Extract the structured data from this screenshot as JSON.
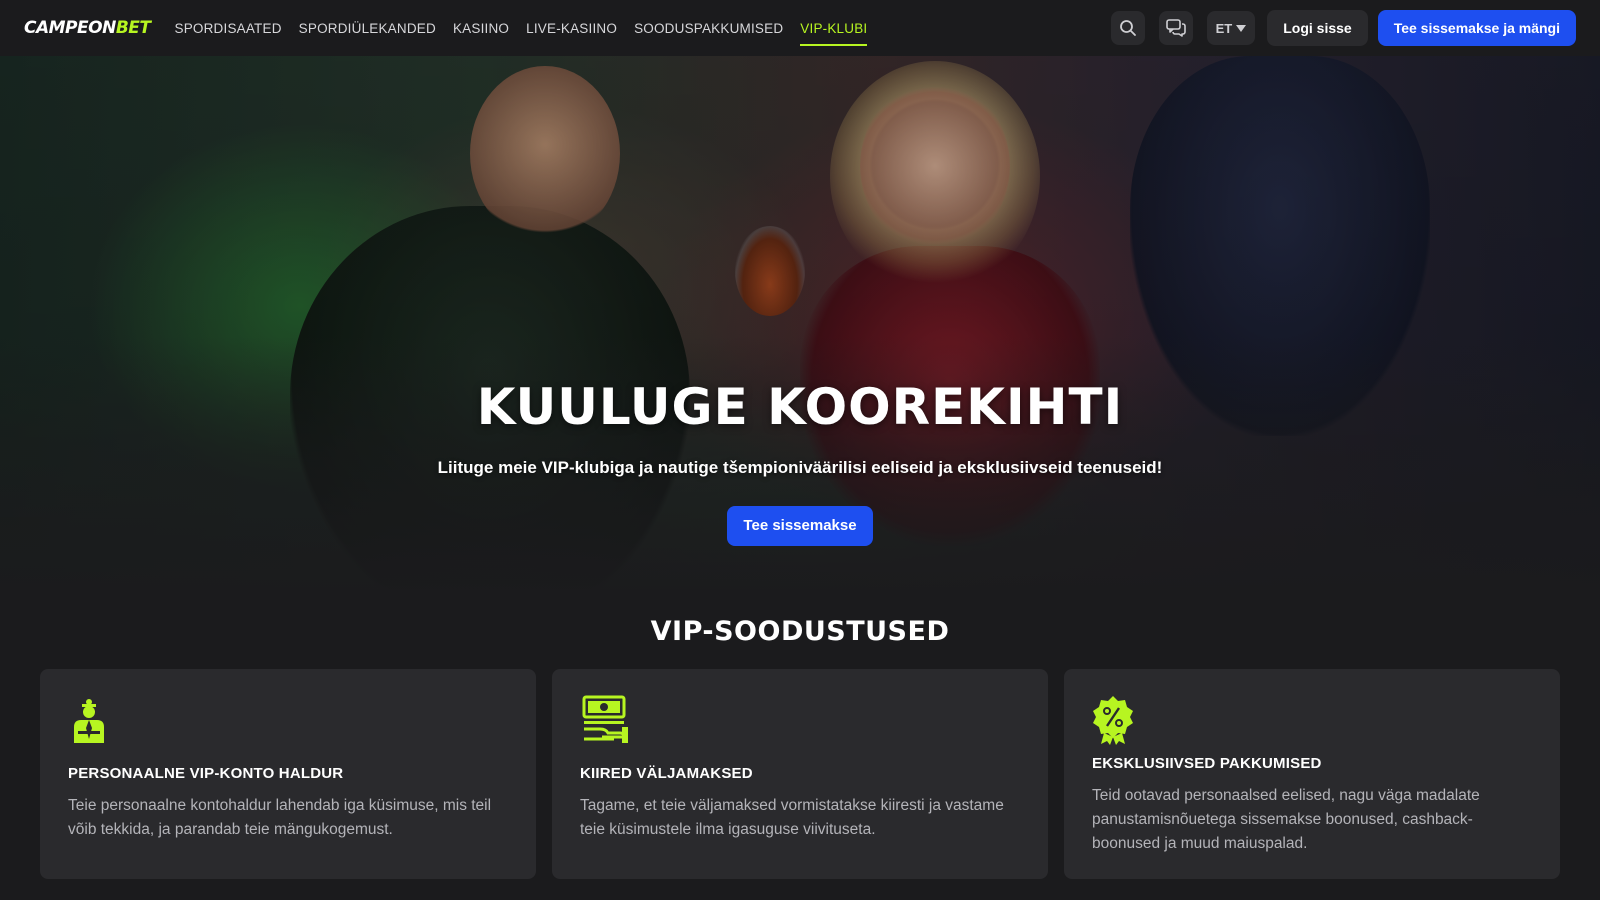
{
  "header": {
    "logo_part1": "CAMPEON",
    "logo_part2": "BET",
    "nav": [
      {
        "label": "SPORDISAATED",
        "active": false
      },
      {
        "label": "SPORDIÜLEKANDED",
        "active": false
      },
      {
        "label": "KASIINO",
        "active": false
      },
      {
        "label": "LIVE-KASIINO",
        "active": false
      },
      {
        "label": "SOODUSPAKKUMISED",
        "active": false
      },
      {
        "label": "VIP-KLUBI",
        "active": true
      }
    ],
    "search_icon": "search-icon",
    "chat_icon": "chat-bubbles-icon",
    "language": "ET",
    "login_label": "Logi sisse",
    "deposit_label": "Tee sissemakse ja mängi"
  },
  "hero": {
    "title": "KUULUGE KOOREKIHTI",
    "subtitle": "Liituge meie VIP-klubiga ja nautige tšempioniväärilisi eeliseid ja eksklusiivseid teenuseid!",
    "cta_label": "Tee sissemakse"
  },
  "benefits": {
    "title": "VIP-SOODUSTUSED",
    "cards": [
      {
        "icon": "personal-manager-icon",
        "title": "PERSONAALNE VIP-KONTO HALDUR",
        "text": "Teie personaalne kontohaldur lahendab iga küsimuse, mis teil võib tekkida, ja parandab teie mängukogemust."
      },
      {
        "icon": "fast-payout-icon",
        "title": "KIIRED VÄLJAMAKSED",
        "text": "Tagame, et teie väljamaksed vormistatakse kiiresti ja vastame teie küsimustele ilma igasuguse viivituseta."
      },
      {
        "icon": "exclusive-offer-badge-icon",
        "title": "EKSKLUSIIVSED PAKKUMISED",
        "text": "Teid ootavad personaalsed eelised, nagu väga madalate panustamisnõuetega sissemakse boonused, cashback-boonused ja muud maiuspalad."
      }
    ]
  },
  "colors": {
    "accent": "#b7f521",
    "primary_button": "#1e4ff0",
    "background": "#1b1b1d",
    "card": "#2a2a2d"
  }
}
